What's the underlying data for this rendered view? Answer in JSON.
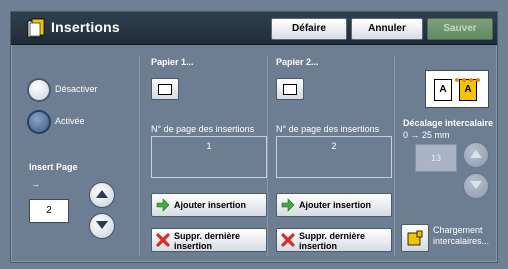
{
  "header": {
    "title": "Insertions",
    "undo_label": "Défaire",
    "cancel_label": "Annuler",
    "save_label": "Sauver"
  },
  "options": {
    "disable_label": "Désactiver",
    "enable_label": "Activée",
    "selected": "Activée"
  },
  "insert_page": {
    "label": "Insert Page",
    "arrow": "→",
    "value": "2"
  },
  "paper1": {
    "label": "Papier 1...",
    "page_field_label": "N° de page des insertions",
    "page_value": "1",
    "add_label": "Ajouter insertion",
    "remove_label_line1": "Suppr. dernière",
    "remove_label_line2": "insertion"
  },
  "paper2": {
    "label": "Papier 2...",
    "page_field_label": "N° de page des insertions",
    "page_value": "2",
    "add_label": "Ajouter insertion",
    "remove_label_line1": "Suppr. dernière",
    "remove_label_line2": "insertion"
  },
  "offset": {
    "title": "Décalage intercalaire",
    "range": "0 → 25 mm",
    "value": "13",
    "preview_letter_1": "A",
    "preview_letter_2": "A"
  },
  "load_tabs": {
    "label_line1": "Chargement",
    "label_line2": "intercalaires..."
  },
  "colors": {
    "header_bg": "#1f2b38",
    "panel_bg": "#6e7e92",
    "save_disabled": "#5f8a62",
    "add_icon": "#3fae3c",
    "remove_icon": "#d92b2b",
    "accent_yellow": "#f5c400"
  }
}
